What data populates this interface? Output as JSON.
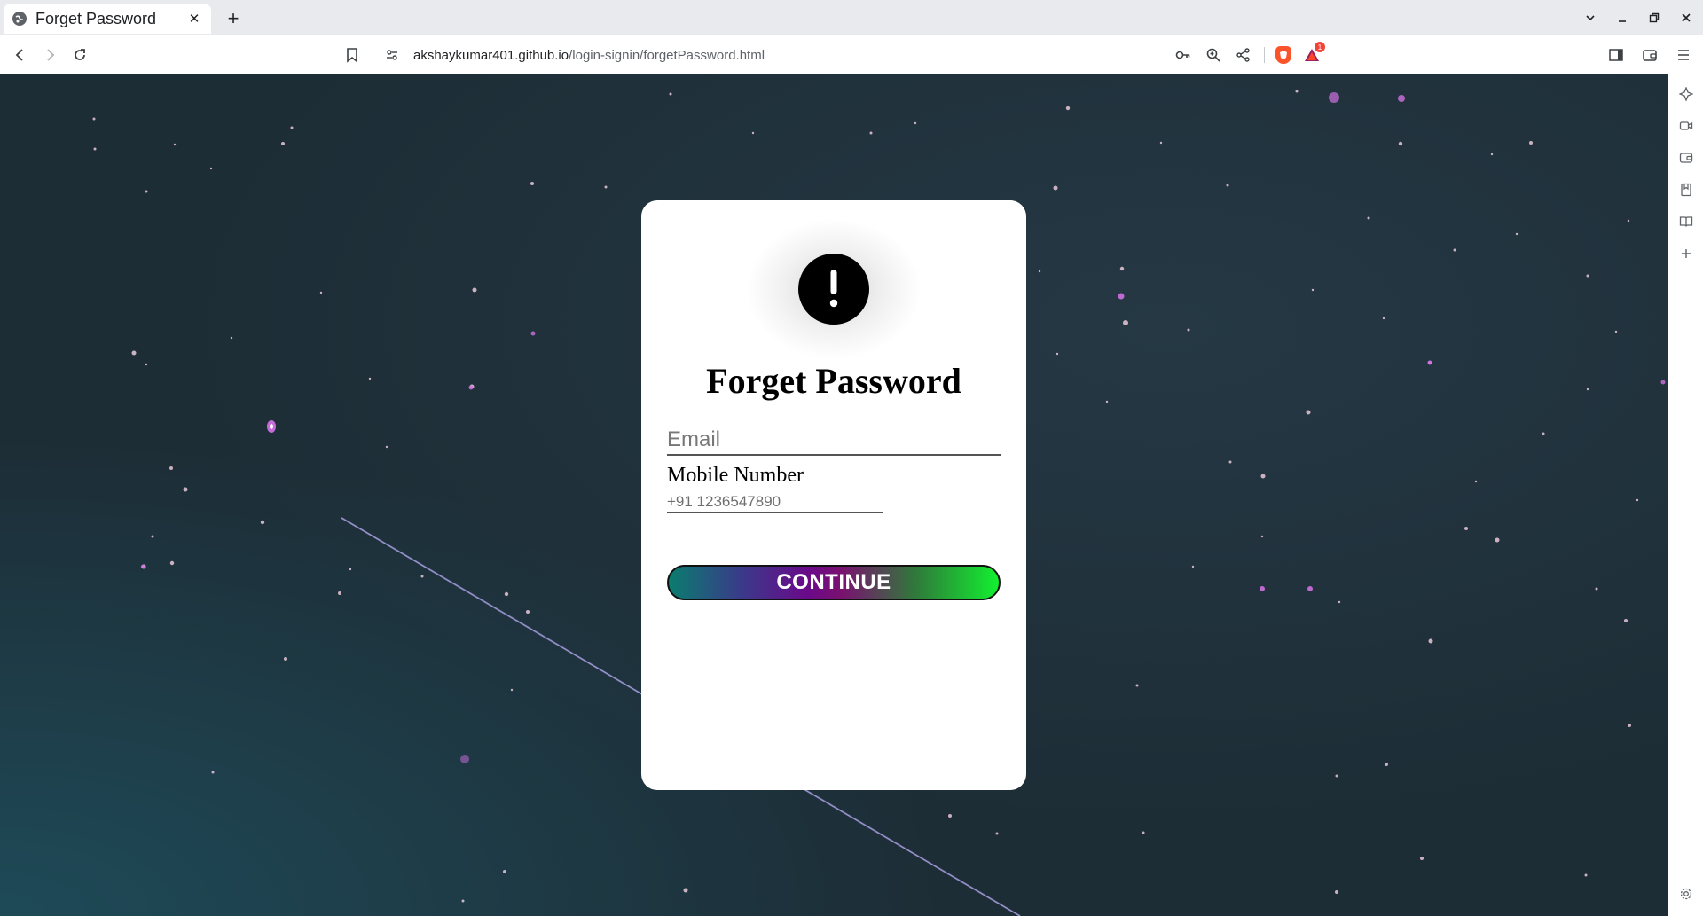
{
  "browser": {
    "tab": {
      "title": "Forget Password",
      "favicon": "globe-icon",
      "close_glyph": "✕"
    },
    "new_tab_glyph": "+",
    "address_bar": {
      "host": "akshaykumar401.github.io",
      "path": "/login-signin/forgetPassword.html"
    },
    "rewards_badge": "1",
    "colors": {
      "brave_orange": "#fb542b",
      "badge_red": "#f44336"
    }
  },
  "page": {
    "alert_icon": "exclamation-icon",
    "title": "Forget Password",
    "email_placeholder": "Email",
    "mobile_label": "Mobile Number",
    "mobile_placeholder": "+91 1236547890",
    "continue_label": "CONTINUE",
    "colors": {
      "background": "#1d2d36",
      "card": "#ffffff",
      "button_gradient": [
        "#0a7d6e",
        "#6a0a8a",
        "#12f030"
      ]
    }
  }
}
